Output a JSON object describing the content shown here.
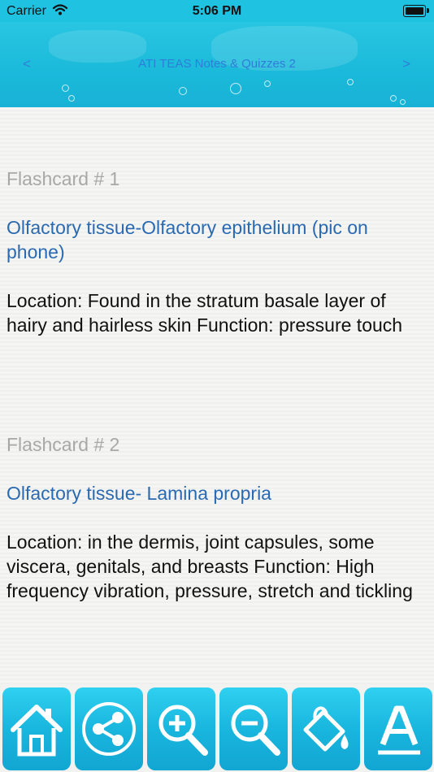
{
  "status_bar": {
    "carrier": "Carrier",
    "time": "5:06 PM"
  },
  "nav": {
    "prev_label": "<",
    "title": "ATI TEAS Notes & Quizzes 2",
    "next_label": ">"
  },
  "cards": [
    {
      "heading": "Flashcard # 1",
      "term": "Olfactory tissue-Olfactory epithelium (pic on phone)",
      "definition": "Location: Found in the stratum basale layer of hairy and hairless skin Function: pressure touch"
    },
    {
      "heading": "Flashcard # 2",
      "term": "Olfactory tissue- Lamina propria",
      "definition": "Location: in the dermis, joint capsules, some viscera, genitals, and breasts Function: High frequency vibration, pressure, stretch and tickling"
    }
  ],
  "toolbar": {
    "buttons": [
      {
        "icon": "home-icon"
      },
      {
        "icon": "share-icon"
      },
      {
        "icon": "zoom-in-icon"
      },
      {
        "icon": "zoom-out-icon"
      },
      {
        "icon": "paint-bucket-icon"
      },
      {
        "icon": "font-icon"
      }
    ]
  },
  "colors": {
    "header_bg": "#1fc2e0",
    "nav_text": "#2f7dd8",
    "heading_text": "#a8a8a8",
    "term_text": "#2a6ab2",
    "definition_text": "#111111"
  }
}
